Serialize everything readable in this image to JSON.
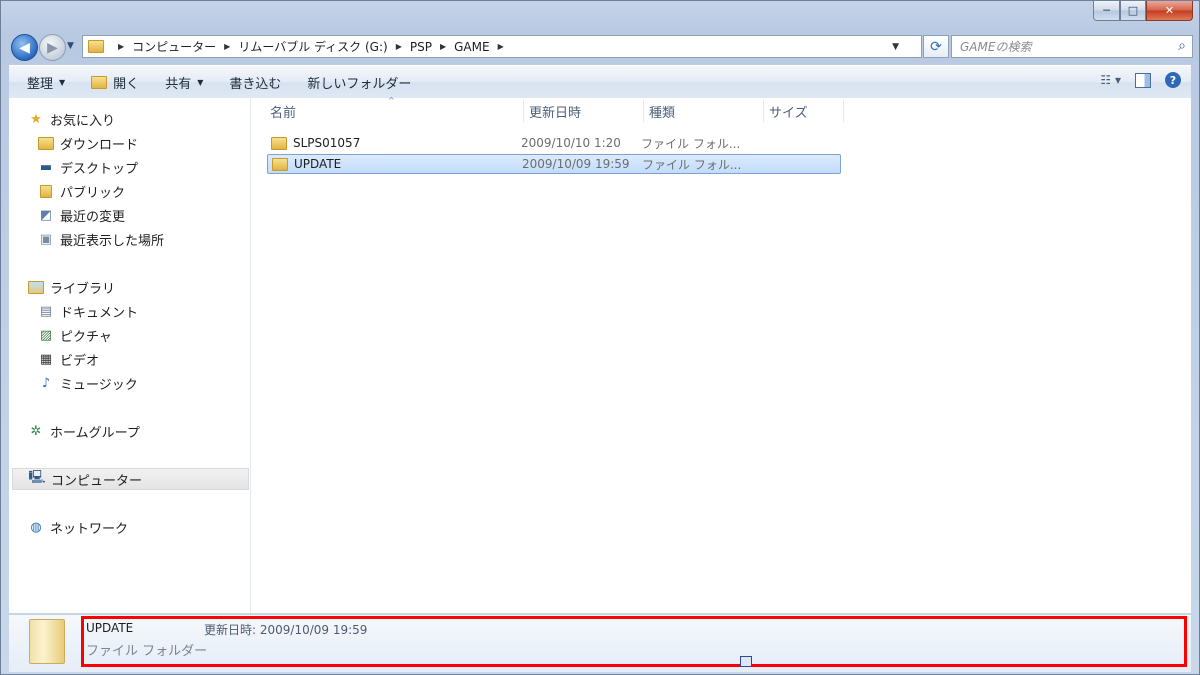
{
  "title_bar": {
    "min": "─",
    "max": "□",
    "close": "✕"
  },
  "nav": {
    "back_glyph": "◀",
    "fwd_glyph": "▶",
    "breadcrumbs": [
      "コンピューター",
      "リムーバブル ディスク (G:)",
      "PSP",
      "GAME"
    ],
    "search_placeholder": "GAMEの検索"
  },
  "toolbar": {
    "organize": "整理",
    "open": "開く",
    "share": "共有",
    "burn": "書き込む",
    "new_folder": "新しいフォルダー"
  },
  "sidebar": {
    "favorites": {
      "label": "お気に入り",
      "items": [
        "ダウンロード",
        "デスクトップ",
        "パブリック",
        "最近の変更",
        "最近表示した場所"
      ]
    },
    "libraries": {
      "label": "ライブラリ",
      "items": [
        "ドキュメント",
        "ピクチャ",
        "ビデオ",
        "ミュージック"
      ]
    },
    "homegroup": "ホームグループ",
    "computer": "コンピューター",
    "network": "ネットワーク"
  },
  "columns": {
    "name": "名前",
    "date": "更新日時",
    "type": "種類",
    "size": "サイズ"
  },
  "files": [
    {
      "name": "SLPS01057",
      "date": "2009/10/10 1:20",
      "type": "ファイル フォル..."
    },
    {
      "name": "UPDATE",
      "date": "2009/10/09 19:59",
      "type": "ファイル フォル..."
    }
  ],
  "details": {
    "name": "UPDATE",
    "type": "ファイル フォルダー",
    "date": "更新日時: 2009/10/09 19:59"
  },
  "colors": {
    "selection": "#c1dcfc",
    "highlight_box": "#ff0000"
  }
}
